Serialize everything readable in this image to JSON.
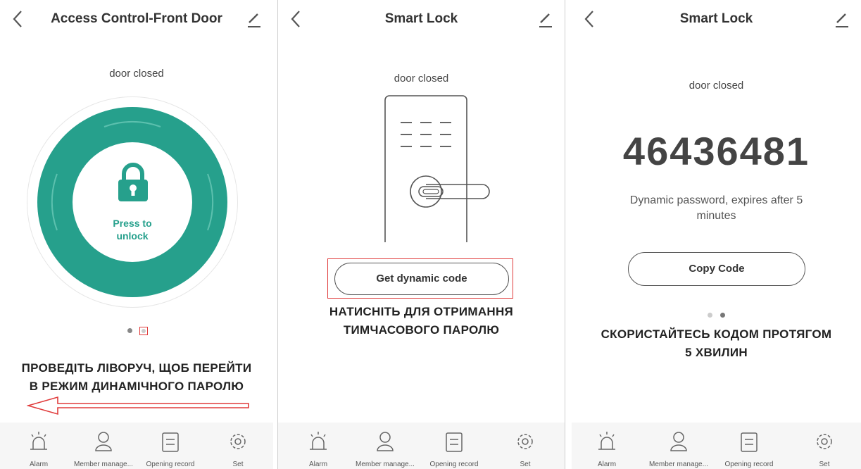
{
  "screens": [
    {
      "title": "Access Control-Front Door",
      "status": "door closed",
      "unlock_label": "Press to unlock",
      "caption_line1": "Проведіть ліворуч, щоб перейти",
      "caption_line2": "в режим динамічного паролю"
    },
    {
      "title": "Smart Lock",
      "status": "door closed",
      "button_label": "Get dynamic code",
      "caption_line1": "Натисніть для отримання",
      "caption_line2": "тимчасового паролю"
    },
    {
      "title": "Smart Lock",
      "status": "door closed",
      "code": "46436481",
      "note_line1": "Dynamic password, expires after 5",
      "note_line2": "minutes",
      "button_label": "Copy Code",
      "caption_line1": "Скористайтесь кодом протягом",
      "caption_line2": "5 хвилин"
    }
  ],
  "tabs": [
    {
      "label": "Alarm",
      "icon": "alarm-icon"
    },
    {
      "label": "Member manage...",
      "icon": "member-icon"
    },
    {
      "label": "Opening record",
      "icon": "record-icon"
    },
    {
      "label": "Set",
      "icon": "settings-gear-icon"
    }
  ],
  "colors": {
    "accent": "#26a08c",
    "highlight_box": "#e03b3b",
    "text": "#333333"
  }
}
